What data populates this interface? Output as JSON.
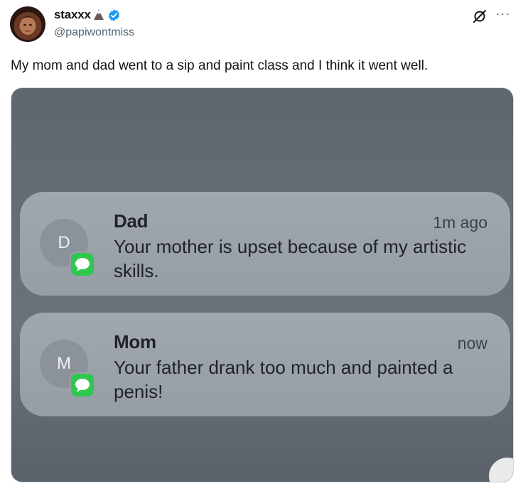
{
  "tweet": {
    "display_name": "staxxx",
    "handle": "@papiwontmiss",
    "text": "My mom and dad went to a sip and paint class and I think it went well.",
    "more_label": "···"
  },
  "icons": {
    "emoji": "volcano-emoji",
    "verified": "verified-badge-icon",
    "grok": "grok-icon",
    "more": "more-icon"
  },
  "colors": {
    "verified_blue": "#1d9bf0",
    "messages_green": "#2ec84f"
  },
  "notifications": [
    {
      "sender": "Dad",
      "initial": "D",
      "time": "1m ago",
      "body": "Your mother is upset because of my artistic skills."
    },
    {
      "sender": "Mom",
      "initial": "M",
      "time": "now",
      "body": "Your father drank too much and painted a penis!"
    }
  ]
}
